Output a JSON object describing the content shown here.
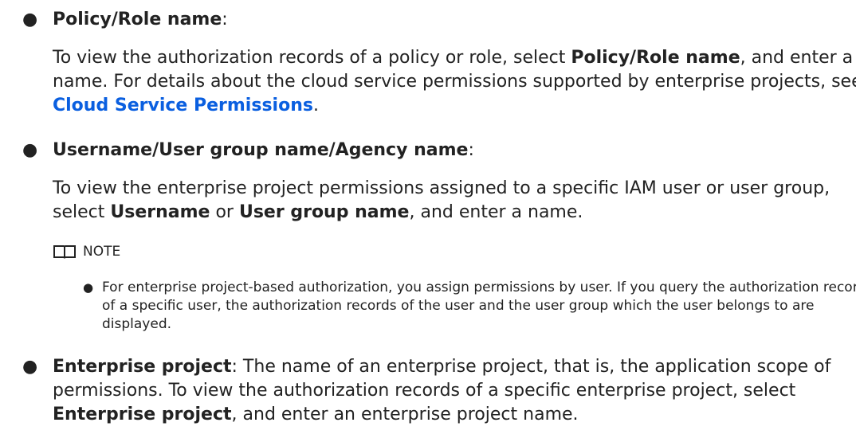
{
  "items": [
    {
      "title_bold": "Policy/Role name",
      "title_suffix": ":",
      "body": {
        "t1": "To view the authorization records of a policy or role, select ",
        "b1": "Policy/Role name",
        "t2": ", and enter a name. For details about the cloud service permissions supported by enterprise projects, see ",
        "link": "Cloud Service Permissions",
        "t3": "."
      }
    },
    {
      "title_bold": "Username/User group name/Agency name",
      "title_suffix": ":",
      "body": {
        "t1": "To view the enterprise project permissions assigned to a specific IAM user or user group, select ",
        "b1": "Username",
        "t2": " or ",
        "b2": "User group name",
        "t3": ", and enter a name."
      },
      "note": {
        "label": "NOTE",
        "icon": "book-icon",
        "entries": [
          "For enterprise project-based authorization, you assign permissions by user. If you query the authorization records of a specific user, the authorization records of the user and the user group which the user belongs to are displayed."
        ]
      }
    },
    {
      "title_bold": "Enterprise project",
      "body": {
        "t1": ": The name of an enterprise project, that is, the application scope of permissions. To view the authorization records of a specific enterprise project, select ",
        "b1": "Enterprise project",
        "t2": ", and enter an enterprise project name."
      }
    }
  ],
  "bullet": "●"
}
